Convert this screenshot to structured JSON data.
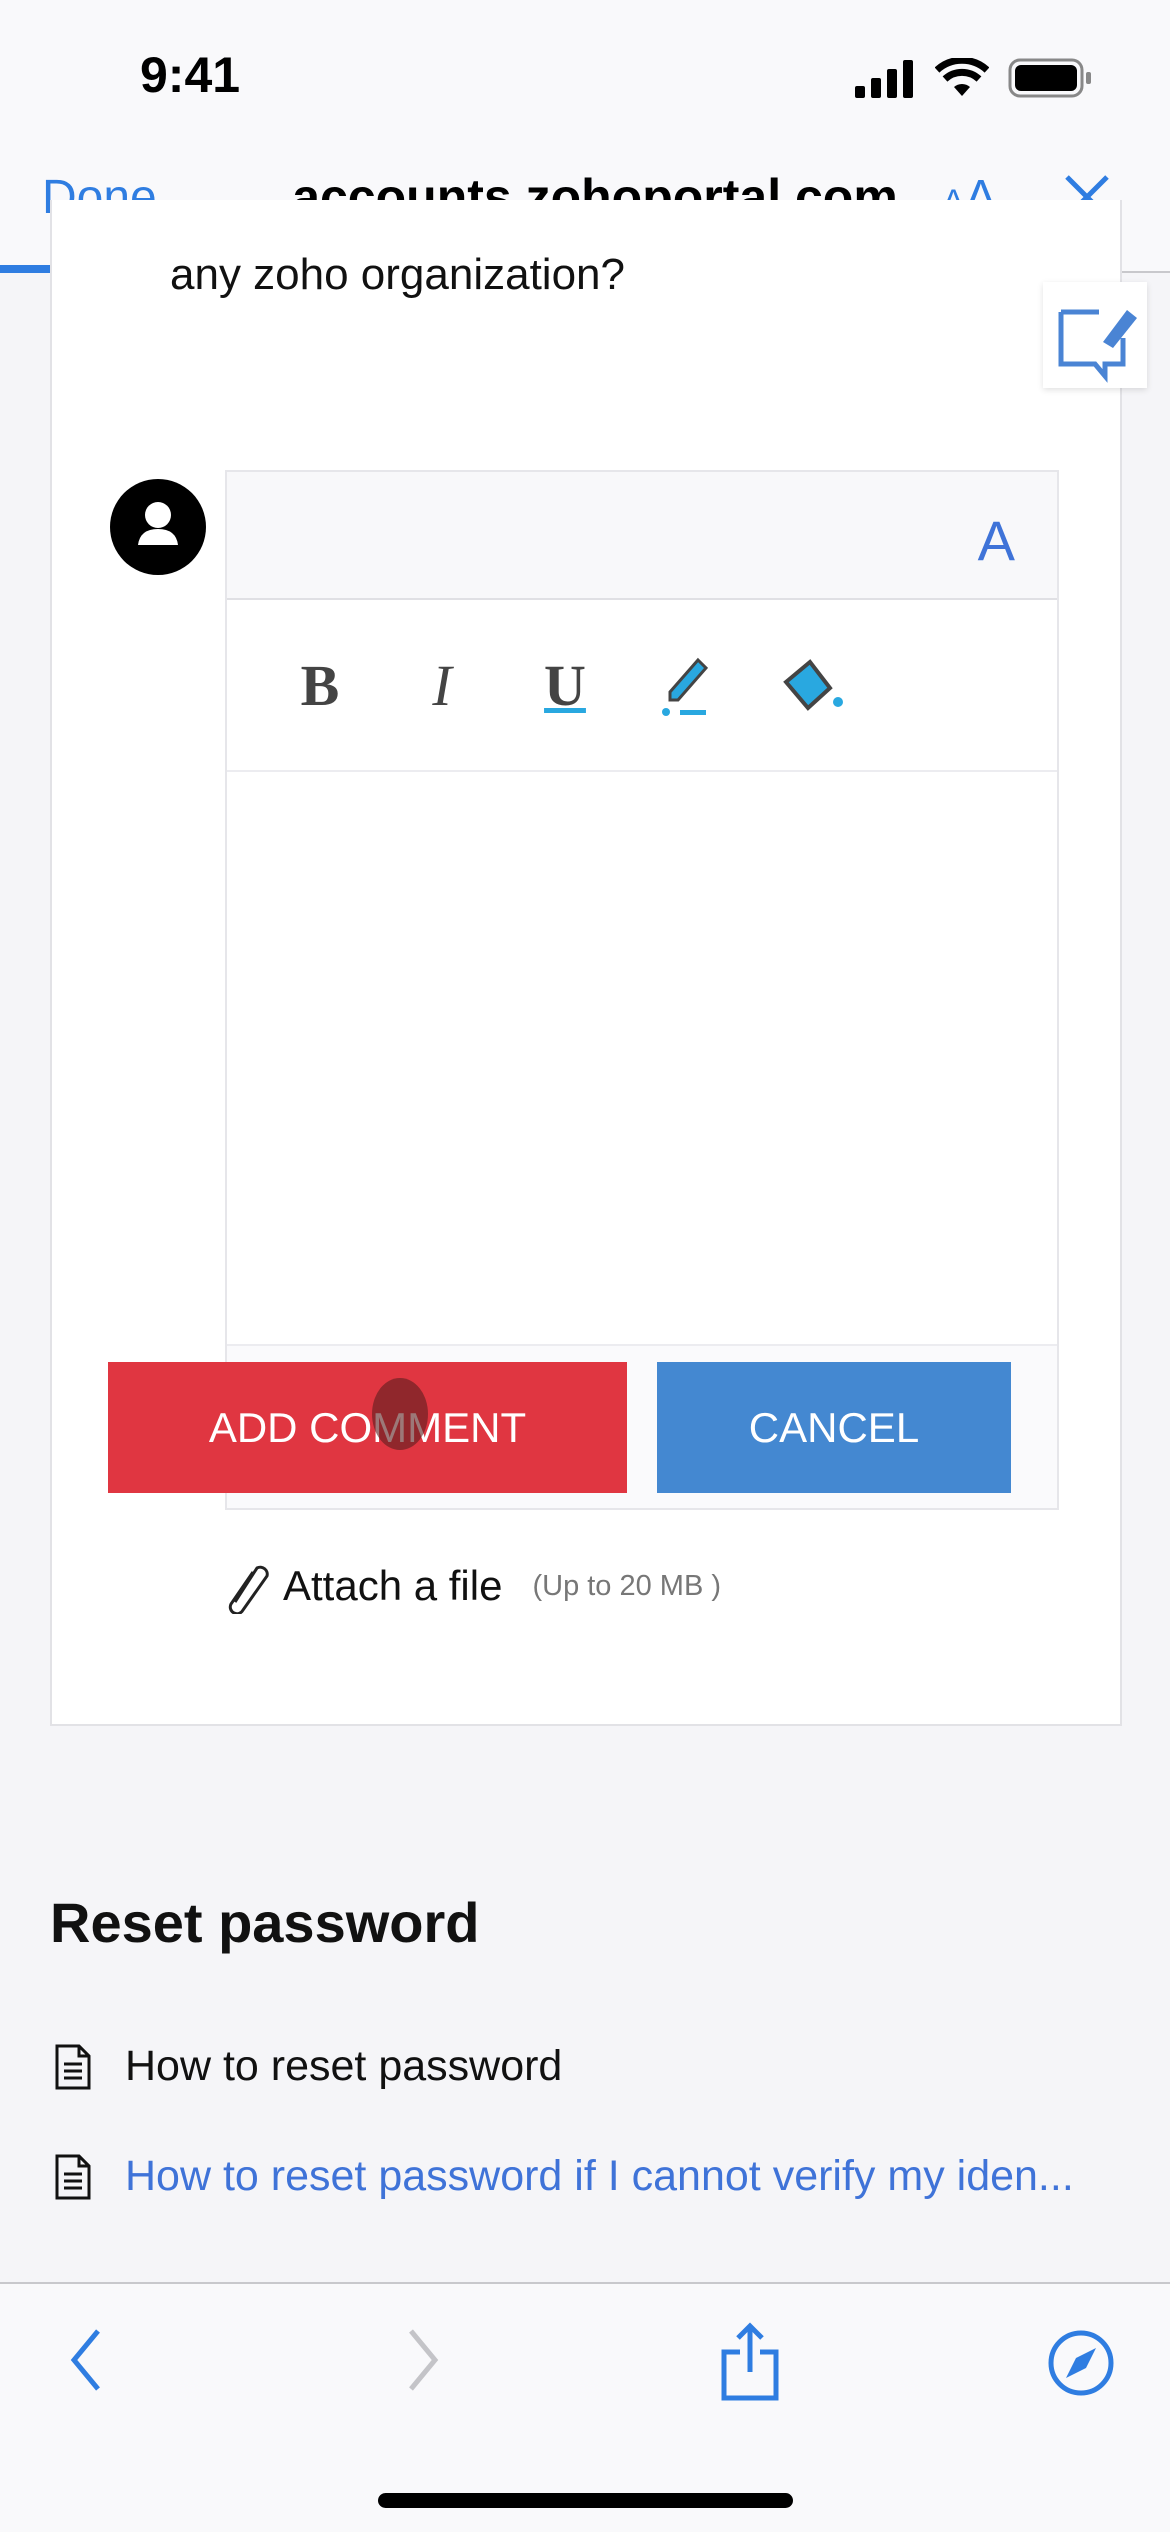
{
  "status_bar": {
    "time": "9:41"
  },
  "browser": {
    "done_label": "Done",
    "url": "accounts.zohoportal.com",
    "text_size_label": "AA",
    "load_progress": 0.1
  },
  "comment": {
    "question_fragment": "any zoho organization?",
    "font_button": "A",
    "toolbar": {
      "bold": "B",
      "italic": "I",
      "underline": "U"
    },
    "body_value": "",
    "add_label": "ADD COMMENT",
    "cancel_label": "CANCEL",
    "attach_label": "Attach a file",
    "attach_limit": "(Up to 20 MB )"
  },
  "related": {
    "title": "Reset password",
    "items": [
      {
        "label": "How to reset password"
      },
      {
        "label": "How to reset password if I cannot verify my iden..."
      }
    ]
  },
  "colors": {
    "accent": "#2f7de1",
    "add": "#e03641",
    "cancel": "#4488d1",
    "link": "#3f73d8"
  }
}
